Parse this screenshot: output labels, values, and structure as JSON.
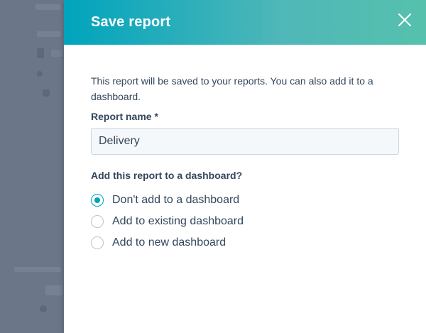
{
  "dialog": {
    "title": "Save report",
    "close_icon": "close-icon",
    "intro_text": "This report will be saved to your reports. You can also add it to a dashboard.",
    "report_name_label": "Report name *",
    "report_name_value": "Delivery",
    "dashboard_question": "Add this report to a dashboard?",
    "options": [
      {
        "label": "Don't add to a dashboard",
        "selected": true
      },
      {
        "label": "Add to existing dashboard",
        "selected": false
      },
      {
        "label": "Add to new dashboard",
        "selected": false
      }
    ]
  },
  "colors": {
    "header_gradient_start": "#00a4bd",
    "header_gradient_end": "#56c1ad",
    "accent": "#00a4bd",
    "text": "#33475b",
    "overlay": "#6b7789"
  }
}
